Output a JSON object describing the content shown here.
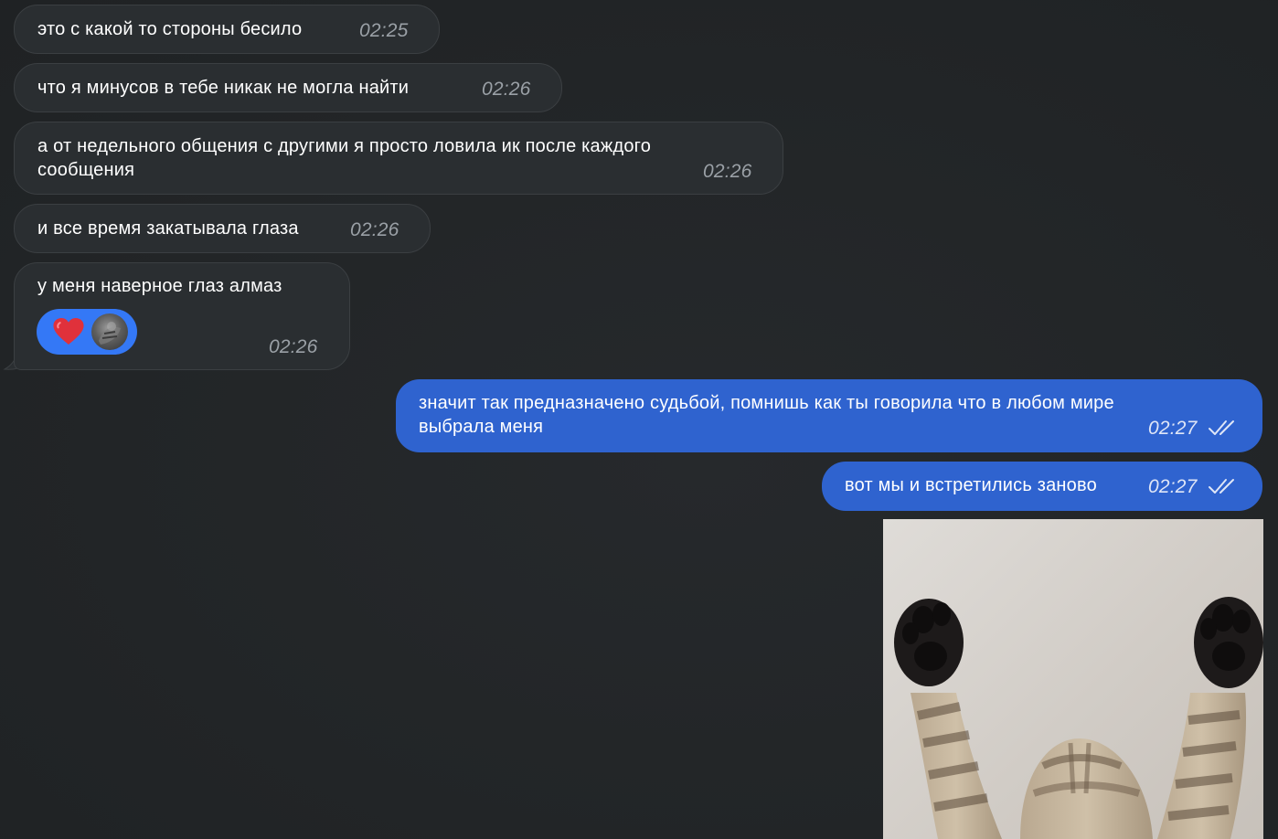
{
  "messages": [
    {
      "text": "это с какой то стороны бесило",
      "time": "02:25"
    },
    {
      "text": "что я минусов в тебе никак не могла найти",
      "time": "02:26"
    },
    {
      "line1": "а от недельного общения с другими я просто ловила ик после каждого",
      "line2": "сообщения",
      "time": "02:26"
    },
    {
      "text": "и все время закатывала глаза",
      "time": "02:26"
    },
    {
      "text": "у меня наверное глаз алмаз",
      "time": "02:26",
      "reaction": {
        "emoji": "heart-icon"
      }
    },
    {
      "line1": "значит так предназначено судьбой, помнишь как ты говорила что в любом мире",
      "line2": "выбрала меня",
      "time": "02:27",
      "status": "read"
    },
    {
      "text": "вот мы и встретились заново",
      "time": "02:27",
      "status": "read"
    }
  ],
  "media": {
    "subject": "cat-raising-paws"
  },
  "colors": {
    "background": "#23272a",
    "incoming_bubble": "#2a2e31",
    "outgoing_bubble": "#2f63cf",
    "reaction_pill": "#3478f6",
    "heart": "#e0313b"
  }
}
